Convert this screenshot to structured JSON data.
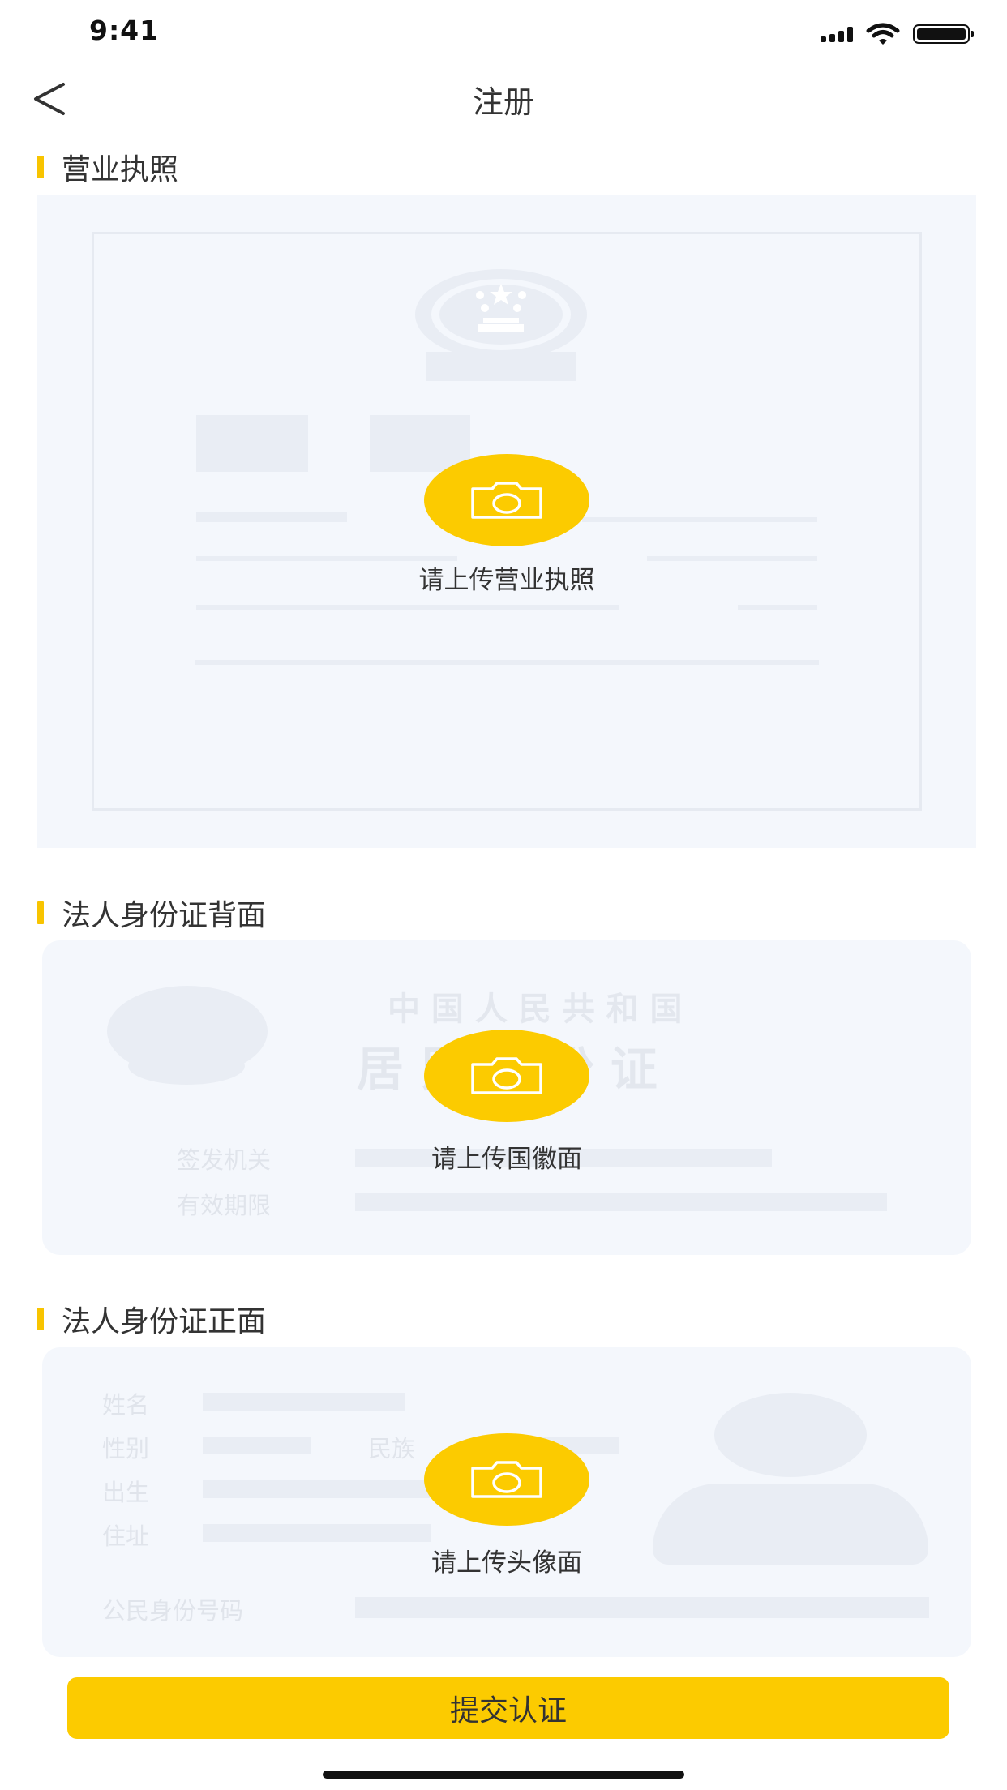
{
  "status_bar": {
    "time": "9:41"
  },
  "nav": {
    "title": "注册"
  },
  "sections": {
    "license": {
      "heading": "营业执照",
      "upload_label": "请上传营业执照"
    },
    "id_back": {
      "heading": "法人身份证背面",
      "card_line1": "中 国 人 民 共 和 国",
      "card_line2": "居 民 身 份 证",
      "field_issuer": "签发机关",
      "field_validity": "有效期限",
      "upload_label": "请上传国徽面"
    },
    "id_front": {
      "heading": "法人身份证正面",
      "field_name": "姓名",
      "field_gender": "性别",
      "field_ethnicity": "民族",
      "field_birth": "出生",
      "field_address": "住址",
      "field_id_number": "公民身份号码",
      "upload_label": "请上传头像面"
    }
  },
  "submit": {
    "label": "提交认证"
  },
  "colors": {
    "accent": "#fccb00",
    "card_bg": "#f4f7fc",
    "placeholder": "#e9edf4"
  },
  "icons": {
    "back": "chevron-left-icon",
    "upload": "camera-icon"
  }
}
